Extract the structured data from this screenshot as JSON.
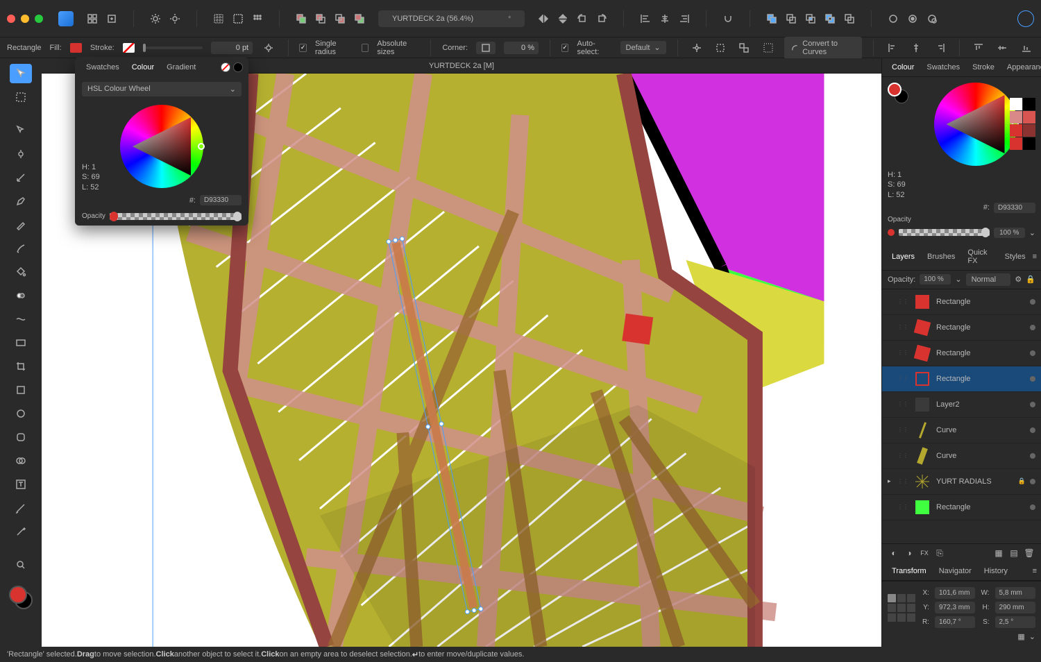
{
  "document": {
    "title": "YURTDECK 2a (56.4%)",
    "tab_title": "YURTDECK 2a [M]",
    "dirty_marker": "*"
  },
  "context_bar": {
    "tool_name": "Rectangle",
    "fill_label": "Fill:",
    "stroke_label": "Stroke:",
    "stroke_width": "0 pt",
    "single_radius_label": "Single radius",
    "absolute_sizes_label": "Absolute sizes",
    "corner_label": "Corner:",
    "corner_value": "0 %",
    "auto_select_label": "Auto-select:",
    "auto_select_value": "Default",
    "convert_label": "Convert to Curves"
  },
  "float_color": {
    "tabs": [
      "Swatches",
      "Colour",
      "Gradient"
    ],
    "mode": "HSL Colour Wheel",
    "hsl": {
      "h": "H: 1",
      "s": "S: 69",
      "l": "L: 52"
    },
    "hex_label": "#:",
    "hex_value": "D93330",
    "opacity_label": "Opacity"
  },
  "right_color": {
    "tabs": [
      "Colour",
      "Swatches",
      "Stroke",
      "Appearance"
    ],
    "hsl": {
      "h": "H: 1",
      "s": "S: 69",
      "l": "L: 52"
    },
    "hex_label": "#:",
    "hex_value": "D93330",
    "opacity_label": "Opacity",
    "opacity_value": "100 %",
    "swatches": [
      "#ffffff",
      "#000000",
      "#d98a88",
      "#d95552",
      "#d93330",
      "#8a3330",
      "#d93330",
      "#000000"
    ]
  },
  "layers_panel": {
    "tabs": [
      "Layers",
      "Brushes",
      "Quick FX",
      "Styles"
    ],
    "opacity_label": "Opacity:",
    "opacity_value": "100 %",
    "blend_mode": "Normal",
    "layers": [
      {
        "name": "Rectangle",
        "thumb_color": "#d93330",
        "rotated": false,
        "selected": false
      },
      {
        "name": "Rectangle",
        "thumb_color": "#d93330",
        "rotated": true,
        "selected": false
      },
      {
        "name": "Rectangle",
        "thumb_color": "#d93330",
        "rotated": true,
        "selected": false
      },
      {
        "name": "Rectangle",
        "thumb_color": "transparent",
        "outline": "#d93330",
        "selected": true
      },
      {
        "name": "Layer2",
        "thumb_color": "#3a3a3a",
        "selected": false
      },
      {
        "name": "Curve",
        "thumb_color": "#b5a82f",
        "thin": true,
        "selected": false
      },
      {
        "name": "Curve",
        "thumb_color": "#b5a82f",
        "thick": true,
        "selected": false
      },
      {
        "name": "YURT RADIALS",
        "thumb_color": "#b5a82f",
        "group": true,
        "locked": true,
        "selected": false
      },
      {
        "name": "Rectangle",
        "thumb_color": "#40ff40",
        "selected": false
      }
    ]
  },
  "transform_panel": {
    "tabs": [
      "Transform",
      "Navigator",
      "History"
    ],
    "x_label": "X:",
    "x_value": "101,6 mm",
    "y_label": "Y:",
    "y_value": "972,3 mm",
    "w_label": "W:",
    "w_value": "5,8 mm",
    "h_label": "H:",
    "h_value": "290 mm",
    "r_label": "R:",
    "r_value": "160,7 °",
    "s_label": "S:",
    "s_value": "2,5 °"
  },
  "statusbar": {
    "text_parts": [
      "'Rectangle' selected. ",
      "Drag",
      " to move selection. ",
      "Click",
      " another object to select it. ",
      "Click",
      " on an empty area to deselect selection. ",
      "↵",
      " to enter move/duplicate values."
    ]
  }
}
